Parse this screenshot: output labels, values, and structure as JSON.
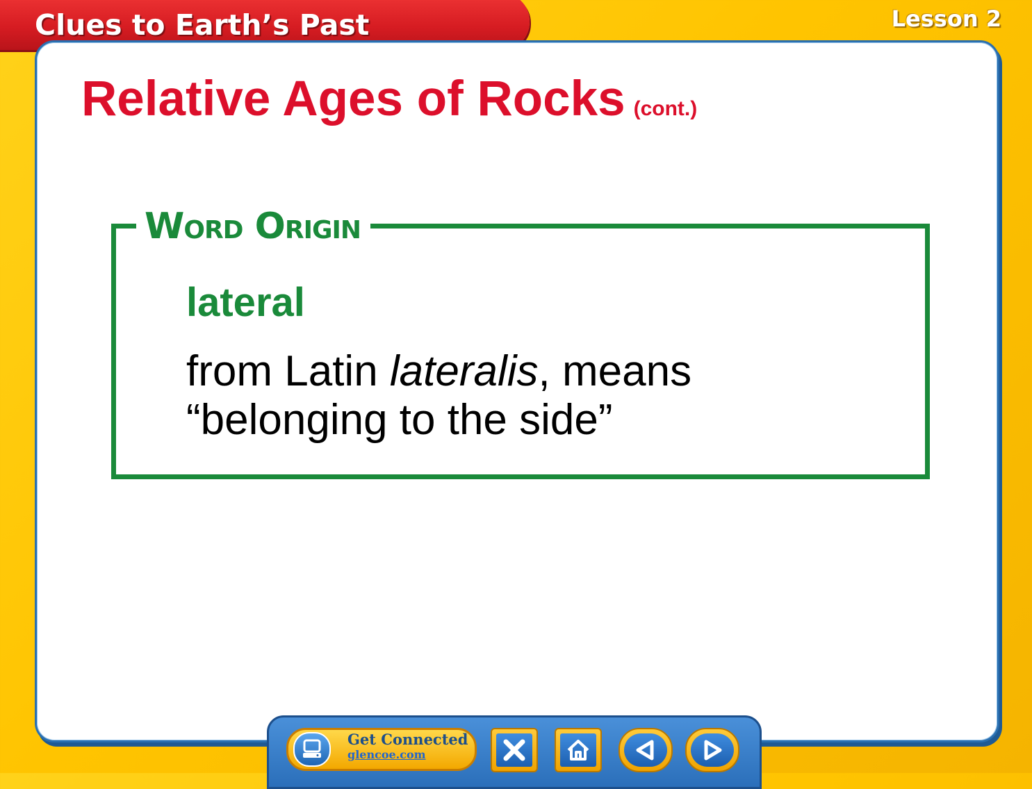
{
  "header": {
    "chapter_title": "Clues to Earth’s Past",
    "lesson_label": "Lesson 2"
  },
  "slide": {
    "title": "Relative Ages of Rocks",
    "title_suffix": "(cont.)",
    "word_origin": {
      "heading": "Word Origin",
      "term": "lateral",
      "definition_prefix": "from Latin ",
      "definition_latin": "lateralis",
      "definition_suffix": ", means",
      "definition_line2": "“belonging to the side”"
    }
  },
  "nav": {
    "get_connected_label": "Get Connected",
    "get_connected_url": "glencoe.com",
    "icons": {
      "get_connected": "computer-icon",
      "exit": "close-icon",
      "home": "home-icon",
      "previous": "arrow-left-icon",
      "next": "arrow-right-icon"
    }
  },
  "colors": {
    "background": "#ffc400",
    "chapter_tab": "#d61c22",
    "title_red": "#dc0f2b",
    "word_origin_green": "#1a8a3a",
    "nav_blue": "#2b6fba",
    "nav_gold": "#f0a300"
  }
}
